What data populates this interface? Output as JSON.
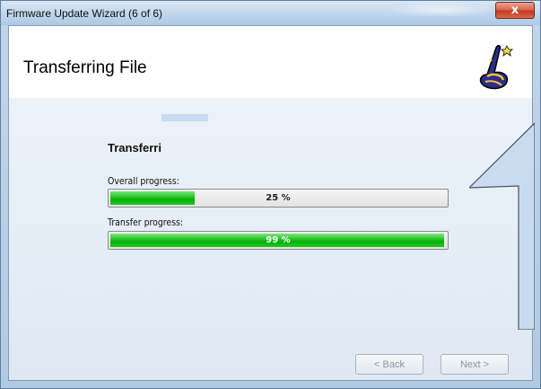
{
  "window": {
    "title": "Firmware Update Wizard (6 of 6)",
    "close_label": "x"
  },
  "header": {
    "title": "Transferring File",
    "icon": "wizard-hat-icon"
  },
  "main": {
    "subtitle": "Transferri",
    "overall": {
      "label": "Overall progress:",
      "text": "25 %",
      "value": 0.25
    },
    "transfer": {
      "label": "Transfer progress:",
      "text": "99 %",
      "value": 0.99
    }
  },
  "buttons": {
    "back_label": "< Back",
    "next_label": "Next >"
  },
  "colors": {
    "progress_fill": "#06b006",
    "close_button": "#c2391c",
    "callout_fill": "#c9dcef"
  }
}
